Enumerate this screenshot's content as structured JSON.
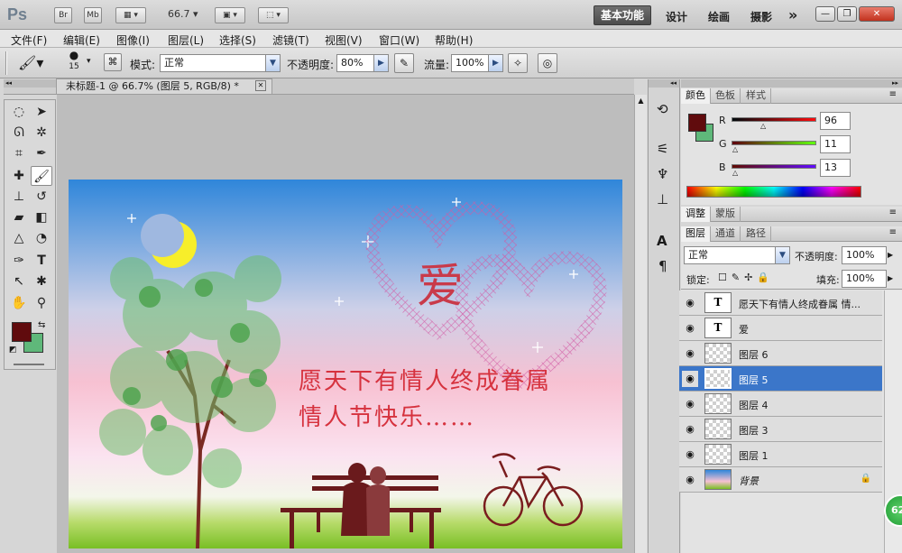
{
  "app": {
    "logo": "Ps",
    "bridge": "Br",
    "minibridge": "Mb",
    "zoom": "66.7",
    "workspaces": {
      "active": "基本功能",
      "design": "设计",
      "painting": "绘画",
      "photography": "摄影",
      "more": "»"
    }
  },
  "menu": [
    "文件(F)",
    "编辑(E)",
    "图像(I)",
    "图层(L)",
    "选择(S)",
    "滤镜(T)",
    "视图(V)",
    "窗口(W)",
    "帮助(H)"
  ],
  "options": {
    "brush_size": "15",
    "mode_label": "模式:",
    "mode_value": "正常",
    "opacity_label": "不透明度:",
    "opacity_value": "80%",
    "flow_label": "流量:",
    "flow_value": "100%"
  },
  "document": {
    "tab_title": "未标题-1 @ 66.7% (图层 5, RGB/8) *",
    "art": {
      "heart_text": "爱",
      "line1": "愿天下有情人终成眷属",
      "line2": "情人节快乐……"
    }
  },
  "color_panel": {
    "tabs": [
      "颜色",
      "色板",
      "样式"
    ],
    "r_label": "R",
    "r": "96",
    "g_label": "G",
    "g": "11",
    "b_label": "B",
    "b": "13",
    "foreground": "#600b0d",
    "background": "#5fb87a"
  },
  "adjust_panel": {
    "tabs": [
      "调整",
      "蒙版"
    ]
  },
  "layers_panel": {
    "tabs": [
      "图层",
      "通道",
      "路径"
    ],
    "blend_mode": "正常",
    "opacity_label": "不透明度:",
    "opacity_value": "100%",
    "lock_label": "锁定:",
    "fill_label": "填充:",
    "fill_value": "100%",
    "layers": [
      {
        "name": "愿天下有情人终成眷属 情...",
        "kind": "text"
      },
      {
        "name": "爱",
        "kind": "text"
      },
      {
        "name": "图层 6",
        "kind": "pixel"
      },
      {
        "name": "图层 5",
        "kind": "pixel",
        "selected": true
      },
      {
        "name": "图层 4",
        "kind": "pixel"
      },
      {
        "name": "图层 3",
        "kind": "pixel"
      },
      {
        "name": "图层 1",
        "kind": "pixel"
      },
      {
        "name": "背景",
        "kind": "background"
      }
    ]
  },
  "badge": "62"
}
